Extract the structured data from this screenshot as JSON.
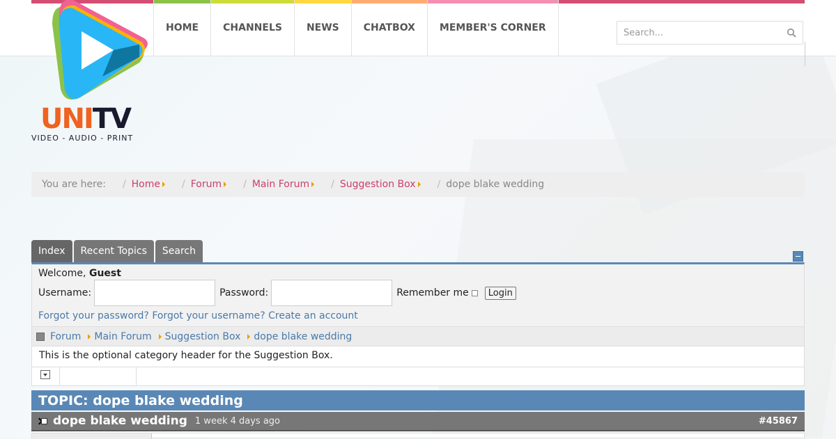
{
  "brand": {
    "name_u": "UNI",
    "name_tv": "TV",
    "tagline": "VIDEO - AUDIO - PRINT",
    "colors": {
      "accent_pink": "#d44d73",
      "forum_blue": "#5a88b6",
      "link_pink": "#c9406b",
      "link_blue": "#4a79a8"
    }
  },
  "nav": {
    "items": [
      {
        "label": "HOME",
        "color": "#8bc34a"
      },
      {
        "label": "CHANNELS",
        "color": "#cddc39"
      },
      {
        "label": "NEWS",
        "color": "#ffd740"
      },
      {
        "label": "CHATBOX",
        "color": "#ffab70"
      },
      {
        "label": "MEMBER'S CORNER",
        "color": "#f48fb1"
      }
    ],
    "search_placeholder": "Search...",
    "search_icon": "search-icon"
  },
  "breadcrumb": {
    "prefix": "You are here:",
    "items": [
      "Home",
      "Forum",
      "Main Forum",
      "Suggestion Box"
    ],
    "current": "dope blake wedding"
  },
  "tabs": [
    "Index",
    "Recent Topics",
    "Search"
  ],
  "login": {
    "welcome_prefix": "Welcome,",
    "welcome_user": "Guest",
    "username_label": "Username:",
    "password_label": "Password:",
    "remember_label": "Remember me",
    "login_button": "Login",
    "forgot_password": "Forgot your password?",
    "forgot_username": "Forgot your username?",
    "create_account": "Create an account"
  },
  "forum_path": [
    "Forum",
    "Main Forum",
    "Suggestion Box",
    "dope blake wedding"
  ],
  "category_header": "This is the optional category header for the Suggestion Box.",
  "topic": {
    "heading": "TOPIC: dope blake wedding",
    "post_title": "dope blake wedding",
    "post_time": "1 week 4 days ago",
    "post_id": "#45867"
  }
}
